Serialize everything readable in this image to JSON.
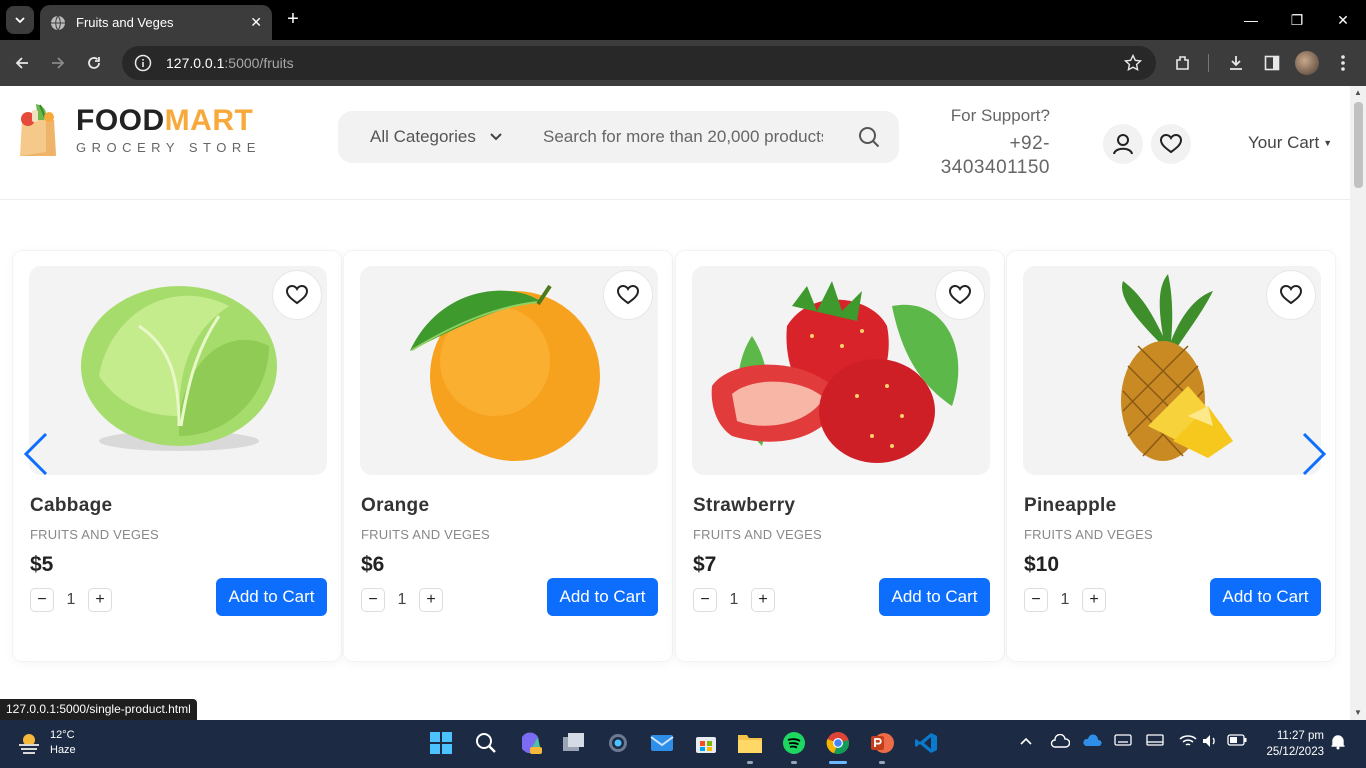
{
  "browser": {
    "tab_title": "Fruits and Veges",
    "url_host": "127.0.0.1",
    "url_path": ":5000/fruits",
    "status_url": "127.0.0.1:5000/single-product.html"
  },
  "header": {
    "logo_food": "FOOD",
    "logo_mart": "MART",
    "logo_sub": "GROCERY STORE",
    "category_select": "All Categories",
    "search_placeholder": "Search for more than 20,000 products",
    "support_label": "For Support?",
    "support_phone_1": "+92-",
    "support_phone_2": "3403401150",
    "cart_label": "Your Cart"
  },
  "products": [
    {
      "name": "Cabbage",
      "category": "FRUITS AND VEGES",
      "price": "$5",
      "qty": "1",
      "add_label": "Add to Cart"
    },
    {
      "name": "Orange",
      "category": "FRUITS AND VEGES",
      "price": "$6",
      "qty": "1",
      "add_label": "Add to Cart"
    },
    {
      "name": "Strawberry",
      "category": "FRUITS AND VEGES",
      "price": "$7",
      "qty": "1",
      "add_label": "Add to Cart"
    },
    {
      "name": "Pineapple",
      "category": "FRUITS AND VEGES",
      "price": "$10",
      "qty": "1",
      "add_label": "Add to Cart"
    }
  ],
  "taskbar": {
    "temp": "12°C",
    "weather": "Haze",
    "time": "11:27 pm",
    "date": "25/12/2023"
  },
  "colors": {
    "accent": "#0d6efd",
    "brand_orange": "#f7a93b",
    "taskbar": "#1c2a44"
  }
}
